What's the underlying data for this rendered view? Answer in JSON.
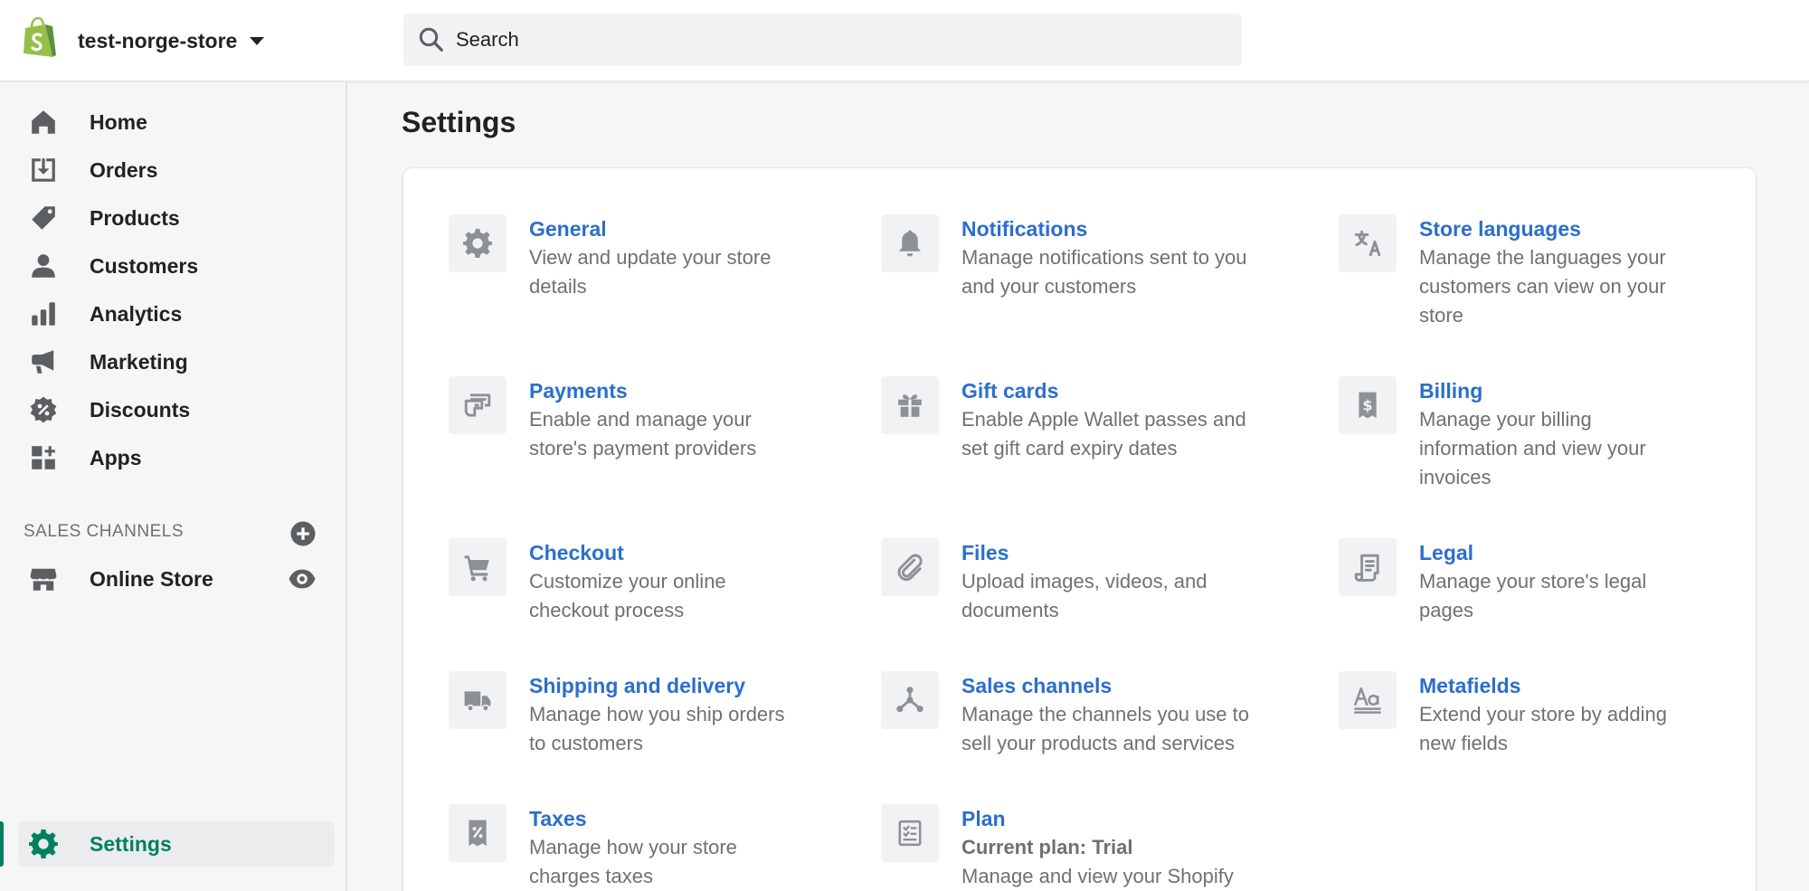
{
  "header": {
    "store_name": "test-norge-store",
    "search_placeholder": "Search"
  },
  "sidebar": {
    "items": [
      {
        "label": "Home",
        "icon": "home-icon"
      },
      {
        "label": "Orders",
        "icon": "orders-icon"
      },
      {
        "label": "Products",
        "icon": "tag-icon"
      },
      {
        "label": "Customers",
        "icon": "person-icon"
      },
      {
        "label": "Analytics",
        "icon": "bar-chart-icon"
      },
      {
        "label": "Marketing",
        "icon": "megaphone-icon"
      },
      {
        "label": "Discounts",
        "icon": "discount-icon"
      },
      {
        "label": "Apps",
        "icon": "apps-icon"
      }
    ],
    "sales_channels_title": "SALES CHANNELS",
    "online_store_label": "Online Store",
    "settings_label": "Settings"
  },
  "main": {
    "title": "Settings",
    "settings": [
      {
        "title": "General",
        "desc": [
          "View and update your store",
          "details"
        ],
        "icon": "gear-icon"
      },
      {
        "title": "Notifications",
        "desc": [
          "Manage notifications sent to you",
          "and your customers"
        ],
        "icon": "bell-icon"
      },
      {
        "title": "Store languages",
        "desc": [
          "Manage the languages your",
          "customers can view on your",
          "store"
        ],
        "icon": "translate-icon"
      },
      {
        "title": "Payments",
        "desc": [
          "Enable and manage your",
          "store's payment providers"
        ],
        "icon": "payment-icon"
      },
      {
        "title": "Gift cards",
        "desc": [
          "Enable Apple Wallet passes and",
          "set gift card expiry dates"
        ],
        "icon": "gift-icon"
      },
      {
        "title": "Billing",
        "desc": [
          "Manage your billing",
          "information and view your",
          "invoices"
        ],
        "icon": "billing-receipt-icon"
      },
      {
        "title": "Checkout",
        "desc": [
          "Customize your online",
          "checkout process"
        ],
        "icon": "cart-icon"
      },
      {
        "title": "Files",
        "desc": [
          "Upload images, videos, and",
          "documents"
        ],
        "icon": "paperclip-icon"
      },
      {
        "title": "Legal",
        "desc": [
          "Manage your store's legal",
          "pages"
        ],
        "icon": "legal-scroll-icon"
      },
      {
        "title": "Shipping and delivery",
        "desc": [
          "Manage how you ship orders",
          "to customers"
        ],
        "icon": "truck-icon"
      },
      {
        "title": "Sales channels",
        "desc": [
          "Manage the channels you use to",
          "sell your products and services"
        ],
        "icon": "channels-icon"
      },
      {
        "title": "Metafields",
        "desc": [
          "Extend your store by adding",
          "new fields"
        ],
        "icon": "metafields-icon"
      },
      {
        "title": "Taxes",
        "desc": [
          "Manage how your store",
          "charges taxes"
        ],
        "icon": "tax-receipt-icon"
      },
      {
        "title": "Plan",
        "strong": "Current plan: Trial",
        "desc": [
          "Manage and view your Shopify"
        ],
        "icon": "plan-checklist-icon"
      }
    ]
  },
  "colors": {
    "accent_green": "#008060",
    "link_blue": "#2c6ecb",
    "shopify_logo": "#95bf47"
  }
}
